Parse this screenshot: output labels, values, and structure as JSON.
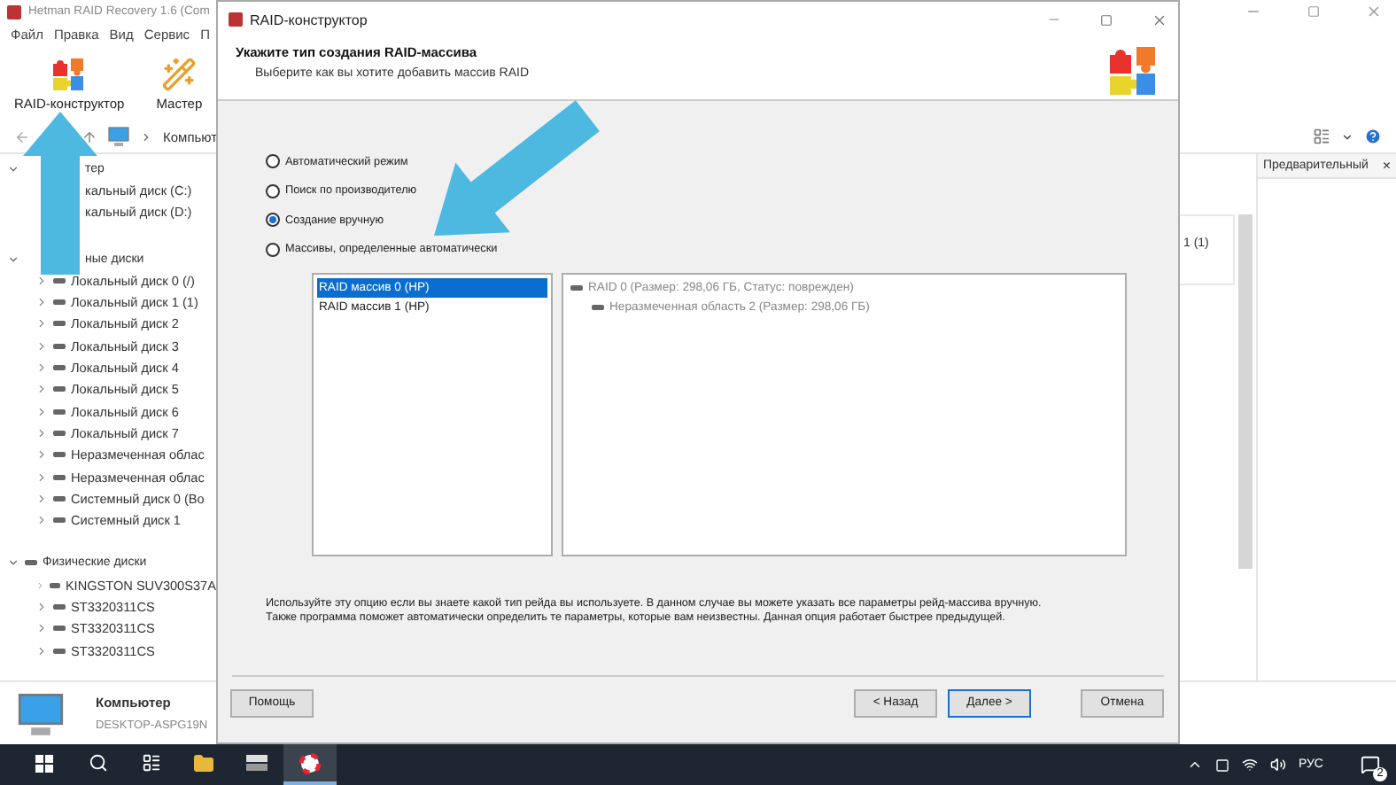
{
  "main_window": {
    "title": "Hetman RAID Recovery 1.6 (Com",
    "menu": [
      "Файл",
      "Правка",
      "Вид",
      "Сервис",
      "П"
    ],
    "toolbar": [
      {
        "label": "RAID-конструктор",
        "kind": "raid"
      },
      {
        "label": "Мастер",
        "kind": "wizard"
      }
    ],
    "breadcrumb": "Компьют",
    "tree": [
      {
        "label": "тер",
        "expanded": true,
        "children": [
          {
            "label": "кальный диск (C:)"
          },
          {
            "label": "кальный диск (D:)"
          }
        ]
      },
      {
        "label": "ные диски",
        "expanded": true,
        "children": [
          {
            "label": "Локальный диск 0 (/)",
            "expanded": false
          },
          {
            "label": "Локальный диск 1 (1)",
            "expanded": false
          },
          {
            "label": "Локальный диск 2",
            "expanded": false
          },
          {
            "label": "Локальный диск 3",
            "expanded": false
          },
          {
            "label": "Локальный диск 4",
            "expanded": false
          },
          {
            "label": "Локальный диск 5",
            "expanded": false
          },
          {
            "label": "Локальный диск 6",
            "expanded": false
          },
          {
            "label": "Локальный диск 7",
            "expanded": false
          },
          {
            "label": "Неразмеченная облас",
            "expanded": false
          },
          {
            "label": "Неразмеченная облас",
            "expanded": false
          },
          {
            "label": "Системный диск 0 (Во",
            "expanded": false
          },
          {
            "label": "Системный диск 1",
            "expanded": false
          }
        ]
      },
      {
        "label": "Физические диски",
        "expanded": true,
        "children": [
          {
            "label": "KINGSTON SUV300S37A",
            "expanded": false
          },
          {
            "label": "ST3320311CS",
            "expanded": false
          },
          {
            "label": "ST3320311CS",
            "expanded": false
          },
          {
            "label": "ST3320311CS",
            "expanded": false
          }
        ]
      }
    ],
    "list_fragment": "1 (1)",
    "preview_panel": {
      "title": "Предварительный",
      "close": "×"
    },
    "footer": {
      "name": "Компьютер",
      "host": "DESKTOP-ASPG19N"
    }
  },
  "dialog": {
    "title": "RAID-конструктор",
    "heading": "Укажите тип создания RAID-массива",
    "subheading": "Выберите как вы хотите добавить массив RAID",
    "modes": [
      {
        "label": "Автоматический режим",
        "selected": false
      },
      {
        "label": "Поиск по производителю",
        "selected": false
      },
      {
        "label": "Создание вручную",
        "selected": true
      },
      {
        "label": "Массивы, определенные автоматически",
        "selected": false
      }
    ],
    "arrays": [
      {
        "label": "RAID массив 0 (HP)",
        "selected": true
      },
      {
        "label": "RAID массив 1 (HP)",
        "selected": false
      }
    ],
    "details": [
      {
        "label": "RAID 0 (Размер: 298,06 ГБ, Статус: поврежден)",
        "children": [
          {
            "label": "Неразмеченная область 2 (Размер: 298,06 ГБ)"
          }
        ]
      }
    ],
    "help_text": [
      "Используйте эту опцию если вы знаете какой тип рейда вы используете. В данном случае вы можете указать все параметры рейд-массива вручную.",
      "Также программа поможет автоматически определить те параметры, которые вам неизвестны. Данная опция работает быстрее предыдущей."
    ],
    "buttons": [
      {
        "label": "Помощь",
        "kind": "help",
        "focused": false
      },
      {
        "label": "< Назад",
        "kind": "back",
        "focused": false
      },
      {
        "label": "Далее >",
        "kind": "next",
        "focused": true
      },
      {
        "label": "Отмена",
        "kind": "cancel",
        "focused": false
      }
    ]
  },
  "taskbar": {
    "language": "РУС",
    "notifications": "2"
  }
}
